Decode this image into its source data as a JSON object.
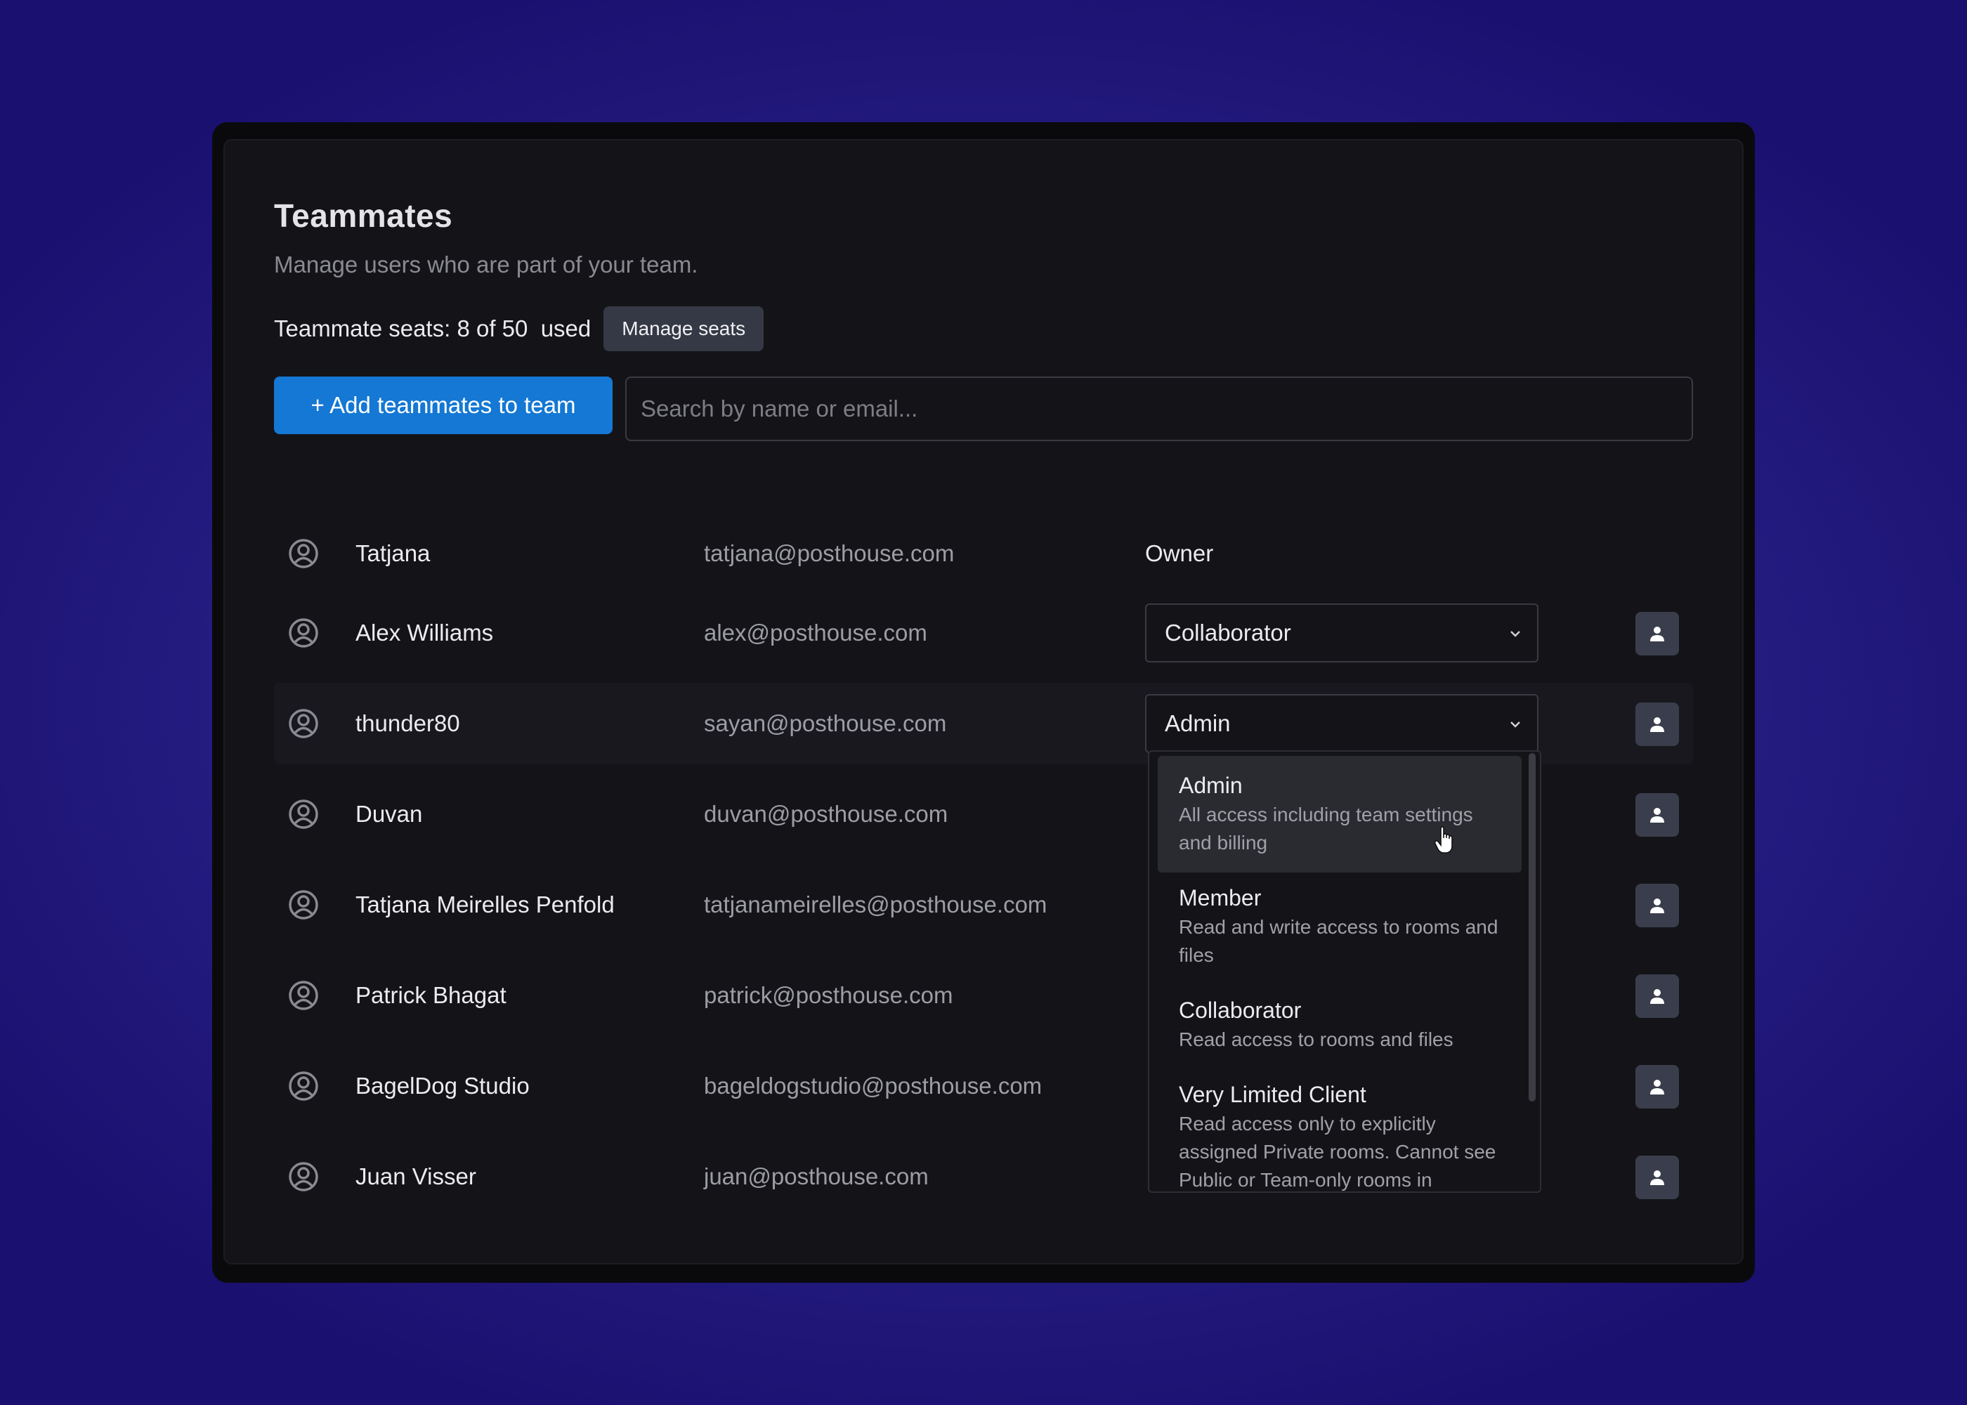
{
  "header": {
    "title": "Teammates",
    "subtitle": "Manage users who are part of your team.",
    "seats_text": "Teammate seats: 8 of 50  used",
    "manage_seats_label": "Manage seats"
  },
  "toolbar": {
    "add_label": "+ Add teammates to team",
    "search_placeholder": "Search by name or email..."
  },
  "members": [
    {
      "name": "Tatjana",
      "email": "tatjana@posthouse.com",
      "role": "Owner"
    },
    {
      "name": "Alex Williams",
      "email": "alex@posthouse.com",
      "role": "Collaborator"
    },
    {
      "name": "thunder80",
      "email": "sayan@posthouse.com",
      "role": "Admin"
    },
    {
      "name": "Duvan",
      "email": "duvan@posthouse.com",
      "role": ""
    },
    {
      "name": "Tatjana Meirelles Penfold",
      "email": "tatjanameirelles@posthouse.com",
      "role": ""
    },
    {
      "name": "Patrick Bhagat",
      "email": "patrick@posthouse.com",
      "role": ""
    },
    {
      "name": "BagelDog Studio",
      "email": "bageldogstudio@posthouse.com",
      "role": ""
    },
    {
      "name": "Juan Visser",
      "email": "juan@posthouse.com",
      "role": ""
    }
  ],
  "role_dropdown": {
    "options": [
      {
        "title": "Admin",
        "desc": "All access including team settings and billing"
      },
      {
        "title": "Member",
        "desc": "Read and write access to rooms and files"
      },
      {
        "title": "Collaborator",
        "desc": "Read access to rooms and files"
      },
      {
        "title": "Very Limited Client",
        "desc": "Read access only to explicitly assigned Private rooms. Cannot see Public or Team-only rooms in"
      }
    ]
  },
  "icons": {
    "avatar": "user-circle-icon",
    "chevron": "chevron-down-icon",
    "row_action": "user-icon",
    "cursor": "hand-pointer-icon"
  },
  "colors": {
    "accent": "#1478d4",
    "background_top": "#5560b8",
    "background_edge": "#1a1070",
    "card": "#141418"
  }
}
